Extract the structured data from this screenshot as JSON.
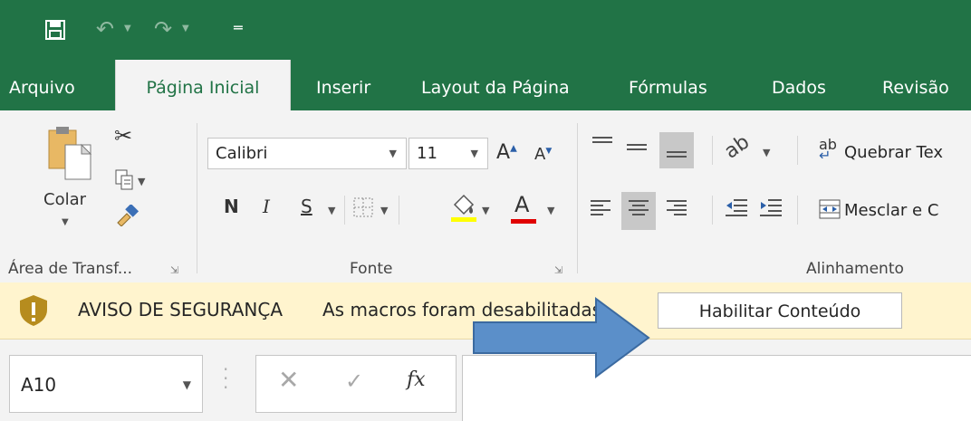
{
  "tabs": [
    {
      "label": "Arquivo",
      "active": false
    },
    {
      "label": "Página Inicial",
      "active": true
    },
    {
      "label": "Inserir",
      "active": false
    },
    {
      "label": "Layout da Página",
      "active": false
    },
    {
      "label": "Fórmulas",
      "active": false
    },
    {
      "label": "Dados",
      "active": false
    },
    {
      "label": "Revisão",
      "active": false
    }
  ],
  "ribbon": {
    "clipboard": {
      "paste_label": "Colar",
      "group_label": "Área de Transf..."
    },
    "font": {
      "group_label": "Fonte",
      "font_name": "Calibri",
      "font_size": "11",
      "bold": "N",
      "italic": "I",
      "underline": "S",
      "increase": "A",
      "decrease": "A",
      "font_color": "A"
    },
    "alignment": {
      "group_label": "Alinhamento",
      "wrap_text": "Quebrar Tex",
      "merge": "Mesclar e C"
    }
  },
  "security_bar": {
    "title": "AVISO DE SEGURANÇA",
    "message": "As macros foram desabilitadas.",
    "button": "Habilitar Conteúdo"
  },
  "formula_bar": {
    "name_box": "A10",
    "formula_value": ""
  },
  "colors": {
    "accent": "#217346",
    "highlight_yellow": "#ffff00",
    "font_red": "#e00000",
    "security_bg": "#fff4ce",
    "arrow_fill": "#5b8fc9"
  }
}
